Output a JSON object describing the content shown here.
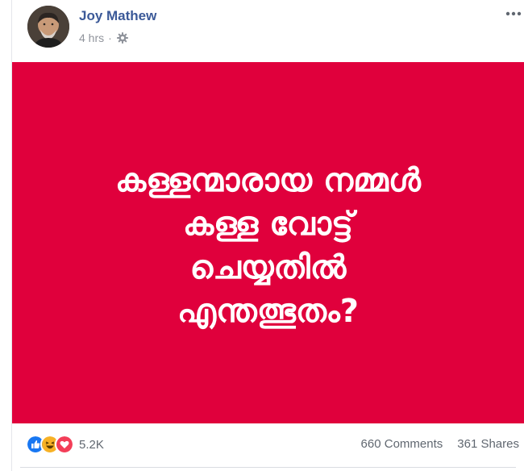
{
  "post": {
    "author": "Joy Mathew",
    "time": "4 hrs",
    "separator": "·",
    "privacy_icon": "gear-icon",
    "more_icon": "more-options-icon",
    "image": {
      "background": "#e0003c",
      "text_lines": [
        "കള്ളന്മാരായ നമ്മൾ",
        "കള്ള വോട്ട്",
        "ചെയ്യതിൽ",
        "എന്തത്ഭുതം?"
      ]
    },
    "reactions": {
      "icons": [
        "like-icon",
        "haha-icon",
        "love-icon"
      ],
      "count": "5.2K"
    },
    "comments": "660 Comments",
    "shares": "361 Shares"
  },
  "colors": {
    "name_link": "#3b5998",
    "meta_text": "#90949c",
    "like": "#1877f2",
    "haha": "#f7b125",
    "love": "#f33e58"
  }
}
